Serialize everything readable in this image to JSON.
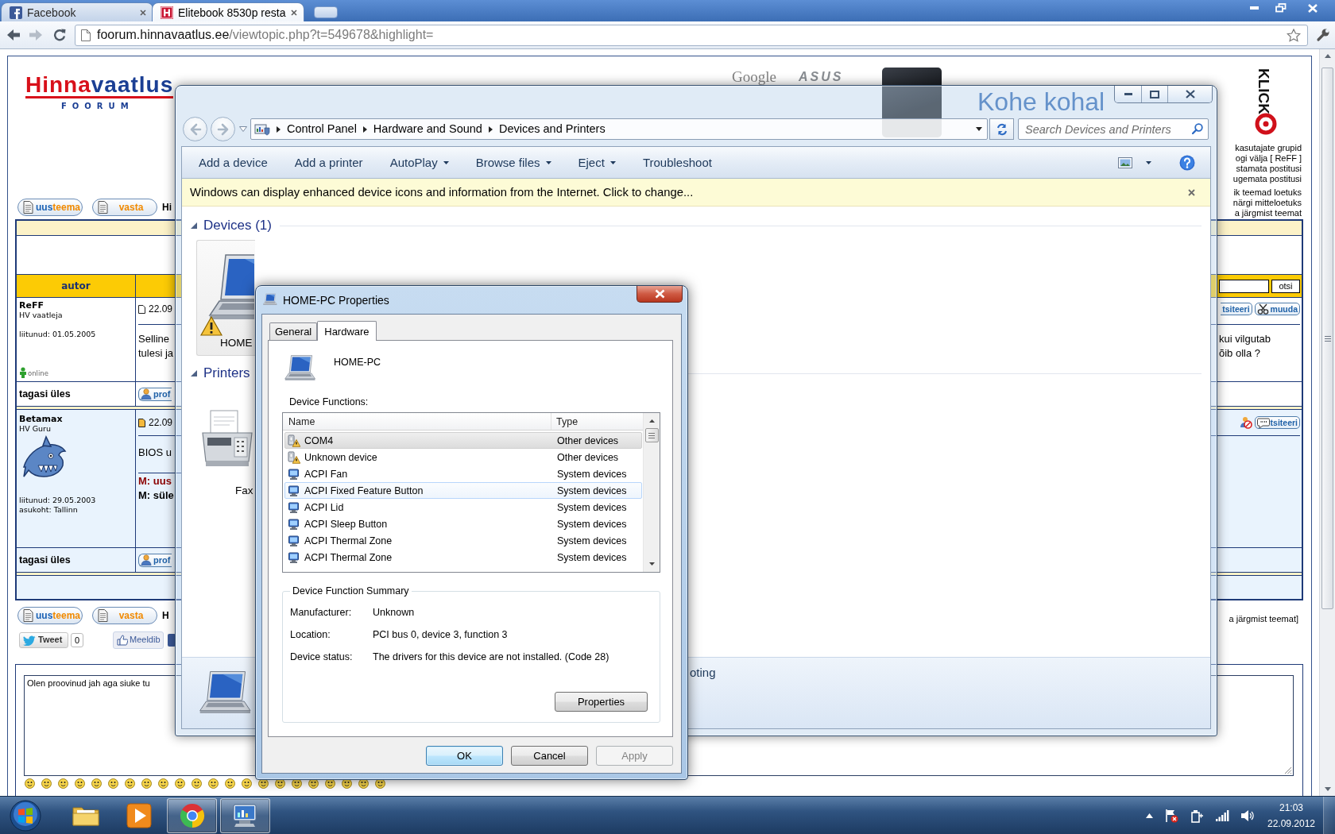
{
  "browser": {
    "tabs": [
      {
        "title": "Facebook",
        "kind": "facebook",
        "selected": false
      },
      {
        "title": "Elitebook 8530p resta",
        "kind": "site",
        "selected": true
      }
    ],
    "back_disabled": false,
    "forward_disabled": true,
    "url": {
      "host": "foorum.hinnavaatlus.ee",
      "path": "/viewtopic.php?t=549678&highlight="
    }
  },
  "forum": {
    "logo": {
      "first": "Hinna",
      "second": "vaatlus",
      "subtitle": "FOORUM"
    },
    "banner": {
      "items": [
        {
          "kind": "google",
          "text": "Google"
        },
        {
          "kind": "asus",
          "text": "ASUS"
        },
        {
          "kind": "phone"
        },
        {
          "kind": "slogan",
          "text": "Kohe kohal"
        }
      ],
      "brand": "KLICK"
    },
    "user_links": [
      "kasutajate grupid",
      "ogi välja [ ReFF ]",
      "stamata postitusi",
      "ugemata postitusi"
    ],
    "topic_links": [
      "ik teemad loetuks",
      "närgi mitteloetuks",
      "a järgmist teemat"
    ],
    "top_bar": {
      "buttons": [
        {
          "kind": "new_topic",
          "parts": [
            "uus",
            "teema"
          ]
        },
        {
          "kind": "reply",
          "parts": [
            "vasta"
          ]
        }
      ],
      "title_fragment": "Hi"
    },
    "table": {
      "author_header": "autor",
      "search_button": "otsi",
      "posts": [
        {
          "author": "ReFF",
          "rank": "HV vaatleja",
          "info": [
            "liitunud: 01.05.2005"
          ],
          "online": "online",
          "unread": false,
          "date": "22.09",
          "actions": [
            {
              "kind": "quote",
              "label": "tsiteeri",
              "cut": true
            },
            {
              "kind": "edit",
              "label": "muuda",
              "cut": false
            }
          ],
          "body_start": [
            "Selline",
            "tulesi ja"
          ],
          "body_end": [
            "kui vilgutab",
            "õib olla ?"
          ],
          "footer": {
            "label": "tagasi üles",
            "button": "prof"
          }
        },
        {
          "author": "Betamax",
          "rank": "HV Guru",
          "avatar": true,
          "info": [
            "liitunud: 29.05.2003",
            "asukoht: Tallinn"
          ],
          "unread": true,
          "date": "22.09",
          "actions": [
            {
              "kind": "ignore"
            },
            {
              "kind": "quote",
              "label": "tsiteeri",
              "cut": false
            }
          ],
          "body_start": [
            "BIOS u"
          ],
          "signature": [
            {
              "kind": "alert",
              "text": "M: uus"
            },
            {
              "kind": "strong",
              "text": "M: süle"
            }
          ],
          "footer": {
            "label": "tagasi üles",
            "button": "prof"
          }
        }
      ]
    },
    "bottom_bar": {
      "buttons": [
        {
          "kind": "new_topic",
          "parts": [
            "uus",
            "teema"
          ]
        },
        {
          "kind": "reply",
          "parts": [
            "vasta"
          ]
        }
      ],
      "title_fragment": "H",
      "nav_fragment": "a järgmist teemat]"
    },
    "social": {
      "tweet": "Tweet",
      "tweet_count": "0",
      "like": "Meeldib"
    },
    "reply": {
      "value": "Olen proovinud jah aga siuke tu"
    }
  },
  "explorer": {
    "back_disabled": true,
    "forward_disabled": true,
    "breadcrumb": [
      "Control Panel",
      "Hardware and Sound",
      "Devices and Printers"
    ],
    "search": {
      "placeholder": "Search Devices and Printers"
    },
    "commands": [
      {
        "label": "Add a device",
        "dropdown": false
      },
      {
        "label": "Add a printer",
        "dropdown": false
      },
      {
        "label": "AutoPlay",
        "dropdown": true
      },
      {
        "label": "Browse files",
        "dropdown": true
      },
      {
        "label": "Eject",
        "dropdown": true
      },
      {
        "label": "Troubleshoot",
        "dropdown": false
      }
    ],
    "info_bar": "Windows can display enhanced device icons and information from the Internet. Click to change...",
    "groups": [
      {
        "title": "Devices (1)",
        "expanded": true,
        "items": [
          {
            "kind": "laptop",
            "label": "HOME",
            "warning": true,
            "selected": true
          }
        ]
      },
      {
        "title": "Printers",
        "expanded": true,
        "items": [
          {
            "kind": "fax",
            "label": "Fax",
            "warning": false,
            "selected": false
          }
        ]
      }
    ],
    "details": {
      "text": "oting"
    }
  },
  "dialog": {
    "title": "HOME-PC Properties",
    "tabs": [
      {
        "label": "General",
        "selected": false
      },
      {
        "label": "Hardware",
        "selected": true
      }
    ],
    "device_name": "HOME-PC",
    "functions_label": "Device Functions:",
    "columns": [
      "Name",
      "Type"
    ],
    "rows": [
      {
        "kind": "warning",
        "name": "COM4",
        "type": "Other devices",
        "selected": true,
        "hovered": false
      },
      {
        "kind": "warning",
        "name": "Unknown device",
        "type": "Other devices",
        "selected": false,
        "hovered": false
      },
      {
        "kind": "system",
        "name": "ACPI Fan",
        "type": "System devices",
        "selected": false,
        "hovered": false
      },
      {
        "kind": "system",
        "name": "ACPI Fixed Feature Button",
        "type": "System devices",
        "selected": false,
        "hovered": true
      },
      {
        "kind": "system",
        "name": "ACPI Lid",
        "type": "System devices",
        "selected": false,
        "hovered": false
      },
      {
        "kind": "system",
        "name": "ACPI Sleep Button",
        "type": "System devices",
        "selected": false,
        "hovered": false
      },
      {
        "kind": "system",
        "name": "ACPI Thermal Zone",
        "type": "System devices",
        "selected": false,
        "hovered": false
      },
      {
        "kind": "system",
        "name": "ACPI Thermal Zone",
        "type": "System devices",
        "selected": false,
        "hovered": false
      }
    ],
    "summary": {
      "title": "Device Function Summary",
      "fields": [
        {
          "label": "Manufacturer:",
          "value": "Unknown"
        },
        {
          "label": "Location:",
          "value": "PCI bus 0, device 3, function 3"
        },
        {
          "label": "Device status:",
          "value": "The drivers for this device are not installed. (Code 28)"
        }
      ],
      "button": "Properties"
    },
    "buttons": [
      {
        "label": "OK",
        "default": true,
        "disabled": false
      },
      {
        "label": "Cancel",
        "default": false,
        "disabled": false
      },
      {
        "label": "Apply",
        "default": false,
        "disabled": true
      }
    ]
  },
  "taskbar": {
    "apps": [
      {
        "kind": "folder",
        "running": false
      },
      {
        "kind": "media",
        "running": false
      },
      {
        "kind": "browser",
        "running": true
      },
      {
        "kind": "control_panel",
        "running": true
      }
    ],
    "clock": {
      "time": "21:03",
      "date": "22.09.2012"
    }
  }
}
